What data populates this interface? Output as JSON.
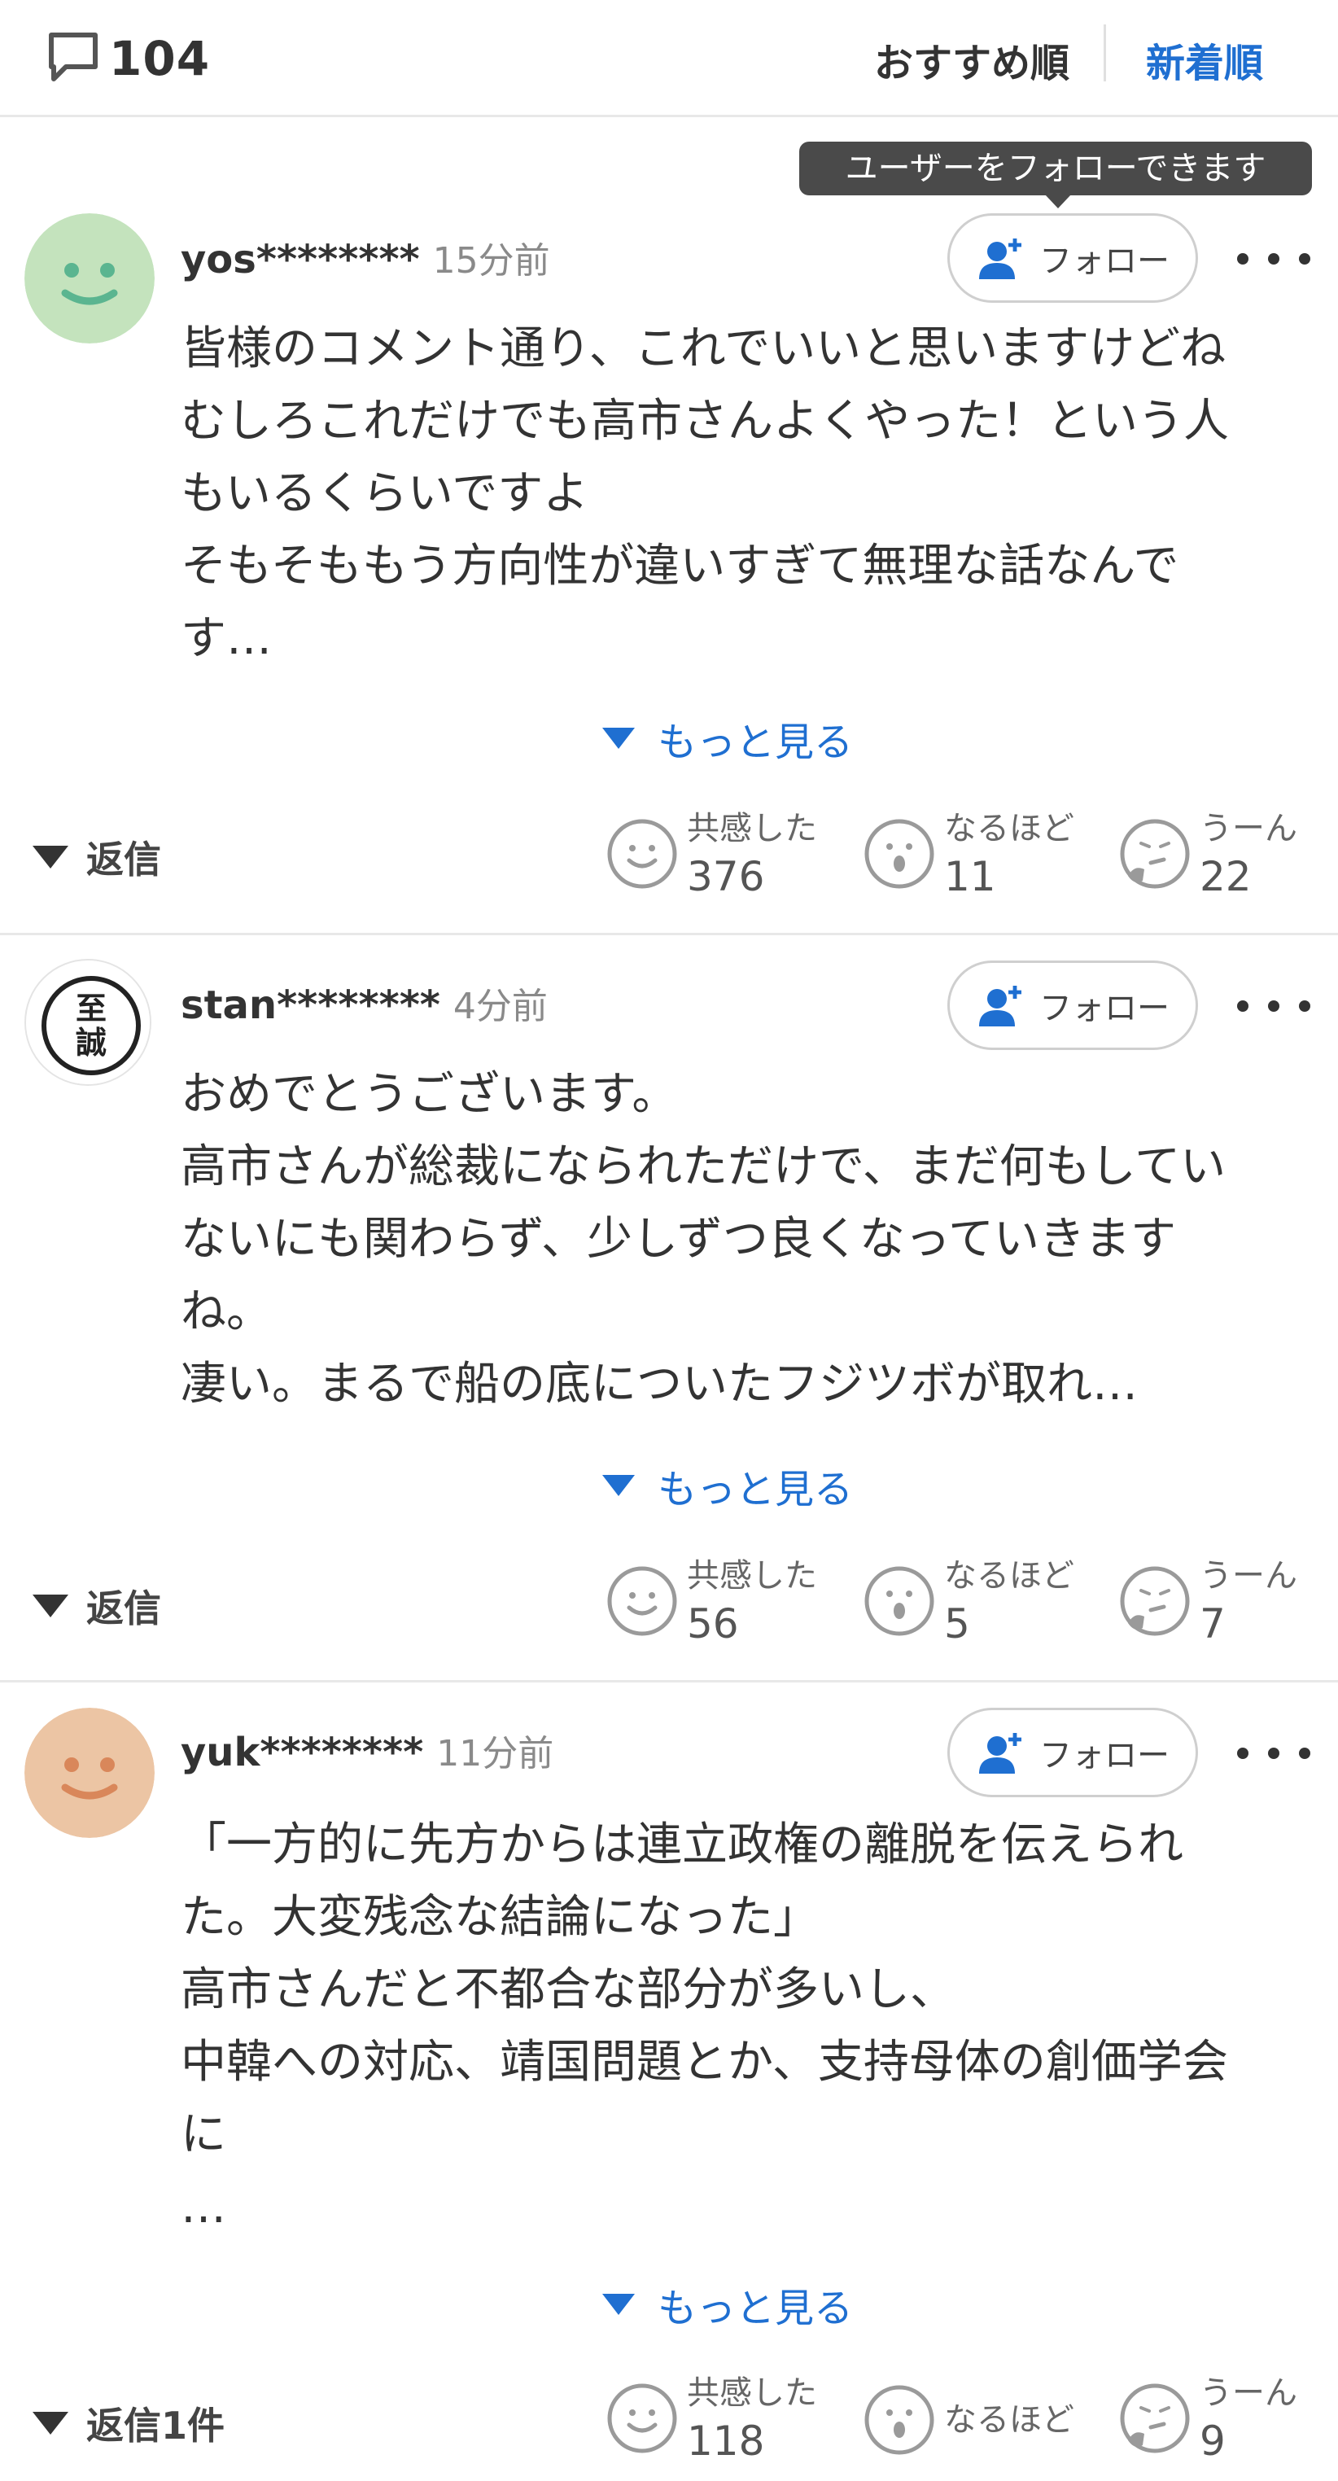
{
  "header": {
    "comment_count": "104",
    "sort_recommended": "おすすめ順",
    "sort_newest": "新着順"
  },
  "tooltip": "ユーザーをフォローできます",
  "follow_label": "フォロー",
  "see_more_label": "もっと見る",
  "reaction_labels": {
    "empathy": "共感した",
    "convinced": "なるほど",
    "hmm": "うーん"
  },
  "colors": {
    "accent": "#1f6fd1",
    "avatar_green": "#c4e3bd",
    "avatar_orange": "#ecc5a4"
  },
  "comments": [
    {
      "user": "yos********",
      "time": "15分前",
      "avatar": "smiley-green-icon",
      "text": "皆様のコメント通り、これでいいと思いますけどね\nむしろこれだけでも高市さんよくやった！という人\nもいるくらいですよ\nそもそももう方向性が違いすぎて無理な話なんで\nす…",
      "reply": "返信",
      "empathy": "376",
      "convinced": "11",
      "hmm": "22"
    },
    {
      "user": "stan********",
      "time": "4分前",
      "avatar": "stamp-seal-icon",
      "avatar_text": "至誠",
      "text": "おめでとうございます。\n高市さんが総裁になられただけで、まだ何もしてい\nないにも関わらず、少しずつ良くなっていきます\nね。\n凄い。まるで船の底についたフジツボが取れ…",
      "reply": "返信",
      "empathy": "56",
      "convinced": "5",
      "hmm": "7"
    },
    {
      "user": "yuk********",
      "time": "11分前",
      "avatar": "smiley-orange-icon",
      "text": "「一方的に先方からは連立政権の離脱を伝えられ\nた。大変残念な結論になった」\n高市さんだと不都合な部分が多いし、\n中韓への対応、靖国問題とか、支持母体の創価学会\nに\n…",
      "reply": "返信1件",
      "empathy": "118",
      "convinced": "",
      "hmm": "9"
    }
  ]
}
